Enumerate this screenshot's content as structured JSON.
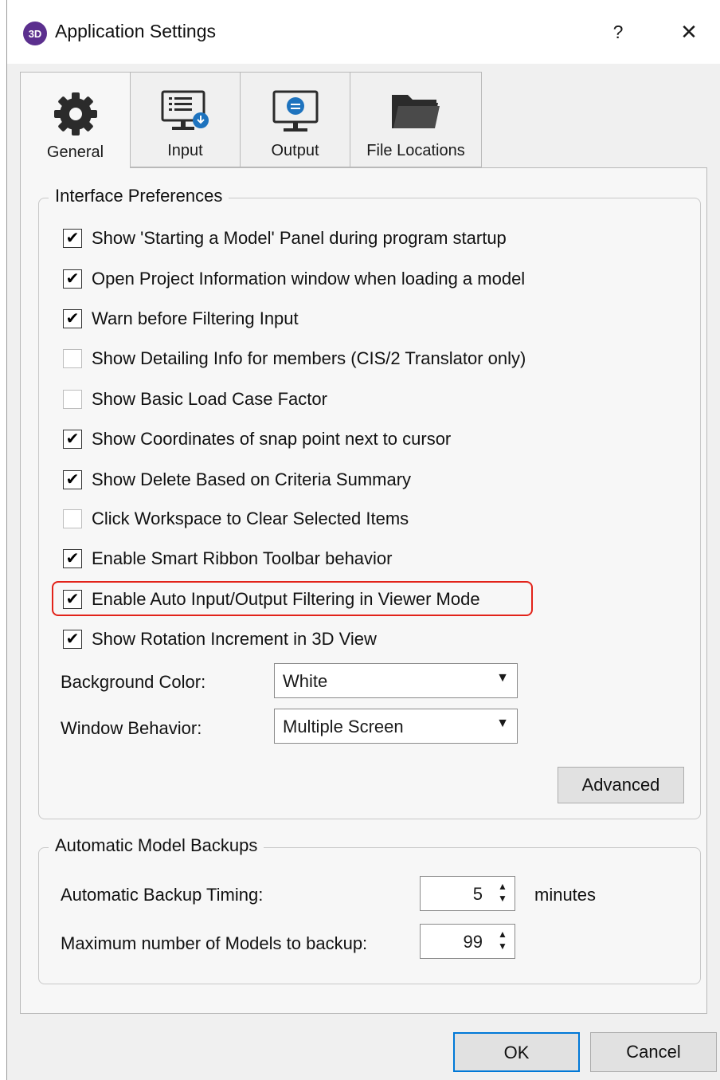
{
  "window": {
    "title": "Application Settings",
    "app_badge": "3D",
    "help": "?",
    "close": "✕"
  },
  "tabs": [
    {
      "label": "General",
      "icon": "gear-icon",
      "active": true
    },
    {
      "label": "Input",
      "icon": "input-monitor-icon",
      "active": false
    },
    {
      "label": "Output",
      "icon": "output-monitor-icon",
      "active": false
    },
    {
      "label": "File Locations",
      "icon": "folder-icon",
      "active": false
    }
  ],
  "interface": {
    "title": "Interface Preferences",
    "options": [
      {
        "label": "Show 'Starting a Model' Panel during program startup",
        "checked": true
      },
      {
        "label": "Open Project Information window when loading a model",
        "checked": true
      },
      {
        "label": "Warn before Filtering Input",
        "checked": true
      },
      {
        "label": "Show Detailing Info for members (CIS/2 Translator only)",
        "checked": false
      },
      {
        "label": "Show Basic Load Case Factor",
        "checked": false
      },
      {
        "label": "Show Coordinates of snap point next to cursor",
        "checked": true
      },
      {
        "label": "Show Delete Based on Criteria Summary",
        "checked": true
      },
      {
        "label": "Click Workspace to Clear Selected Items",
        "checked": false
      },
      {
        "label": "Enable Smart Ribbon Toolbar behavior",
        "checked": true
      },
      {
        "label": "Enable Auto Input/Output Filtering in Viewer Mode",
        "checked": true
      },
      {
        "label": "Show Rotation Increment in 3D View",
        "checked": true
      }
    ],
    "background_color": {
      "label": "Background Color:",
      "value": "White"
    },
    "window_behavior": {
      "label": "Window Behavior:",
      "value": "Multiple Screen"
    },
    "advanced_label": "Advanced"
  },
  "backups": {
    "title": "Automatic Model Backups",
    "timing": {
      "label": "Automatic Backup Timing:",
      "value": "5",
      "unit": "minutes"
    },
    "max_models": {
      "label": "Maximum number of Models to backup:",
      "value": "99"
    }
  },
  "buttons": {
    "ok": "OK",
    "cancel": "Cancel"
  },
  "colors": {
    "highlight": "#e2231a",
    "badge": "#5b2f8e",
    "ok_border": "#0078d7"
  }
}
